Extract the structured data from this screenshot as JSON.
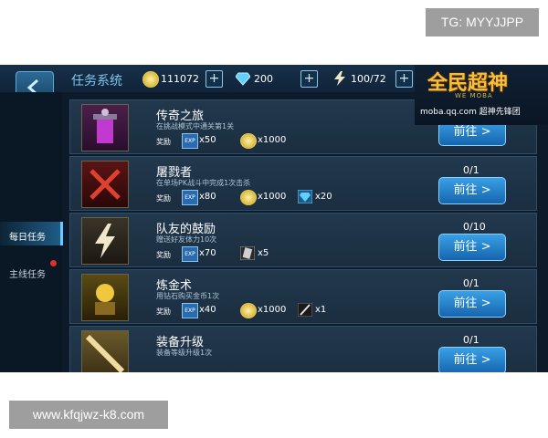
{
  "watermarks": {
    "top_right": "TG: MYYJJPP",
    "bottom_left": "www.kfqjwz-k8.com"
  },
  "header": {
    "title": "任务系统",
    "resources": [
      {
        "icon": "gold-coin-icon",
        "amount": "111072"
      },
      {
        "icon": "diamond-icon",
        "amount": "200"
      },
      {
        "icon": "lightning-icon",
        "amount": "100/72"
      }
    ]
  },
  "logo": {
    "main": "全民超神",
    "sub": "WE MOBA",
    "url": "moba.qq.com 超神先锋团"
  },
  "sidebar": {
    "items": [
      {
        "label": "每日任务",
        "active": true
      },
      {
        "label": "主线任务",
        "active": false
      }
    ]
  },
  "reward_label": "奖励",
  "go_label": "前往 >",
  "tasks": [
    {
      "name": "传奇之旅",
      "desc": "在挑战模式中通关第1关",
      "progress": "",
      "rewards": [
        {
          "icon": "exp-icon",
          "text": "x50"
        },
        {
          "icon": "gold-coin-icon",
          "text": "x1000"
        }
      ]
    },
    {
      "name": "屠戮者",
      "desc": "在单场PK战斗中完成1次击杀",
      "progress": "0/1",
      "rewards": [
        {
          "icon": "exp-icon",
          "text": "x80"
        },
        {
          "icon": "gold-coin-icon",
          "text": "x1000"
        },
        {
          "icon": "diamond-icon",
          "text": "x20"
        }
      ]
    },
    {
      "name": "队友的鼓励",
      "desc": "赠送好友体力10次",
      "progress": "0/10",
      "rewards": [
        {
          "icon": "exp-icon",
          "text": "x70"
        },
        {
          "icon": "card-icon",
          "text": "x5"
        }
      ]
    },
    {
      "name": "炼金术",
      "desc": "用钻石购买金币1次",
      "progress": "0/1",
      "rewards": [
        {
          "icon": "exp-icon",
          "text": "x40"
        },
        {
          "icon": "gold-coin-icon",
          "text": "x1000"
        },
        {
          "icon": "sword-icon",
          "text": "x1"
        }
      ]
    },
    {
      "name": "装备升级",
      "desc": "装备等级升级1次",
      "progress": "0/1",
      "rewards": []
    }
  ],
  "colors": {
    "accent": "#3aa0e6",
    "title": "#7fc6ee",
    "gold": "#f2c03a"
  }
}
